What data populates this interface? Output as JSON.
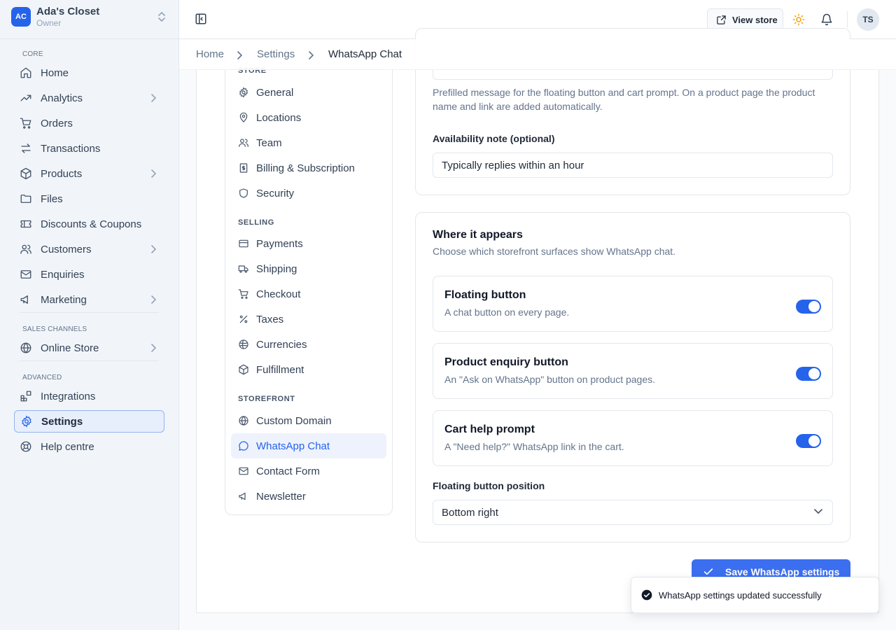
{
  "store": {
    "initials": "AC",
    "name": "Ada's Closet",
    "role": "Owner"
  },
  "sidebar": {
    "sections": {
      "core": "CORE",
      "sales_channels": "SALES CHANNELS",
      "advanced": "ADVANCED"
    },
    "items": [
      {
        "label": "Home",
        "icon": "home-icon"
      },
      {
        "label": "Analytics",
        "icon": "trending-up-icon"
      },
      {
        "label": "Orders",
        "icon": "cart-icon"
      },
      {
        "label": "Transactions",
        "icon": "arrows-exchange-icon"
      },
      {
        "label": "Products",
        "icon": "box-icon"
      },
      {
        "label": "Files",
        "icon": "folder-icon"
      },
      {
        "label": "Discounts & Coupons",
        "icon": "ticket-icon"
      },
      {
        "label": "Customers",
        "icon": "users-icon"
      },
      {
        "label": "Enquiries",
        "icon": "mail-icon"
      },
      {
        "label": "Marketing",
        "icon": "megaphone-icon"
      },
      {
        "label": "Online Store",
        "icon": "globe-icon"
      },
      {
        "label": "Integrations",
        "icon": "blocks-icon"
      },
      {
        "label": "Settings",
        "icon": "gear-icon"
      },
      {
        "label": "Help centre",
        "icon": "lifebuoy-icon"
      }
    ]
  },
  "topbar": {
    "view_store": "View store",
    "user_initials": "TS"
  },
  "breadcrumb": {
    "home": "Home",
    "settings": "Settings",
    "current": "WhatsApp Chat"
  },
  "settings_nav": {
    "sections": {
      "store": "STORE",
      "selling": "SELLING",
      "storefront": "STOREFRONT"
    },
    "items": [
      {
        "label": "General",
        "icon": "gear-icon"
      },
      {
        "label": "Locations",
        "icon": "map-pin-icon"
      },
      {
        "label": "Team",
        "icon": "users-icon"
      },
      {
        "label": "Billing & Subscription",
        "icon": "receipt-icon"
      },
      {
        "label": "Security",
        "icon": "shield-icon"
      },
      {
        "label": "Payments",
        "icon": "credit-card-icon"
      },
      {
        "label": "Shipping",
        "icon": "truck-icon"
      },
      {
        "label": "Checkout",
        "icon": "cart-icon"
      },
      {
        "label": "Taxes",
        "icon": "percent-icon"
      },
      {
        "label": "Currencies",
        "icon": "coins-icon"
      },
      {
        "label": "Fulfillment",
        "icon": "package-icon"
      },
      {
        "label": "Custom Domain",
        "icon": "globe-icon"
      },
      {
        "label": "WhatsApp Chat",
        "icon": "chat-bubble-icon"
      },
      {
        "label": "Contact Form",
        "icon": "mail-icon"
      },
      {
        "label": "Newsletter",
        "icon": "megaphone-icon"
      }
    ]
  },
  "message_section": {
    "help": "Prefilled message for the floating button and cart prompt. On a product page the product name and link are added automatically.",
    "availability_label": "Availability note (optional)",
    "availability_value": "Typically replies within an hour"
  },
  "where_section": {
    "title": "Where it appears",
    "subtitle": "Choose which storefront surfaces show WhatsApp chat.",
    "options": [
      {
        "title": "Floating button",
        "desc": "A chat button on every page.",
        "enabled": true
      },
      {
        "title": "Product enquiry button",
        "desc": "An \"Ask on WhatsApp\" button on product pages.",
        "enabled": true
      },
      {
        "title": "Cart help prompt",
        "desc": "A \"Need help?\" WhatsApp link in the cart.",
        "enabled": true
      }
    ],
    "position_label": "Floating button position",
    "position_value": "Bottom right"
  },
  "save_label": "Save WhatsApp settings",
  "toast": "WhatsApp settings updated successfully",
  "colors": {
    "accent": "#2563eb",
    "sidebar_bg": "#f1f5f9",
    "active_bg": "#e8effc"
  }
}
